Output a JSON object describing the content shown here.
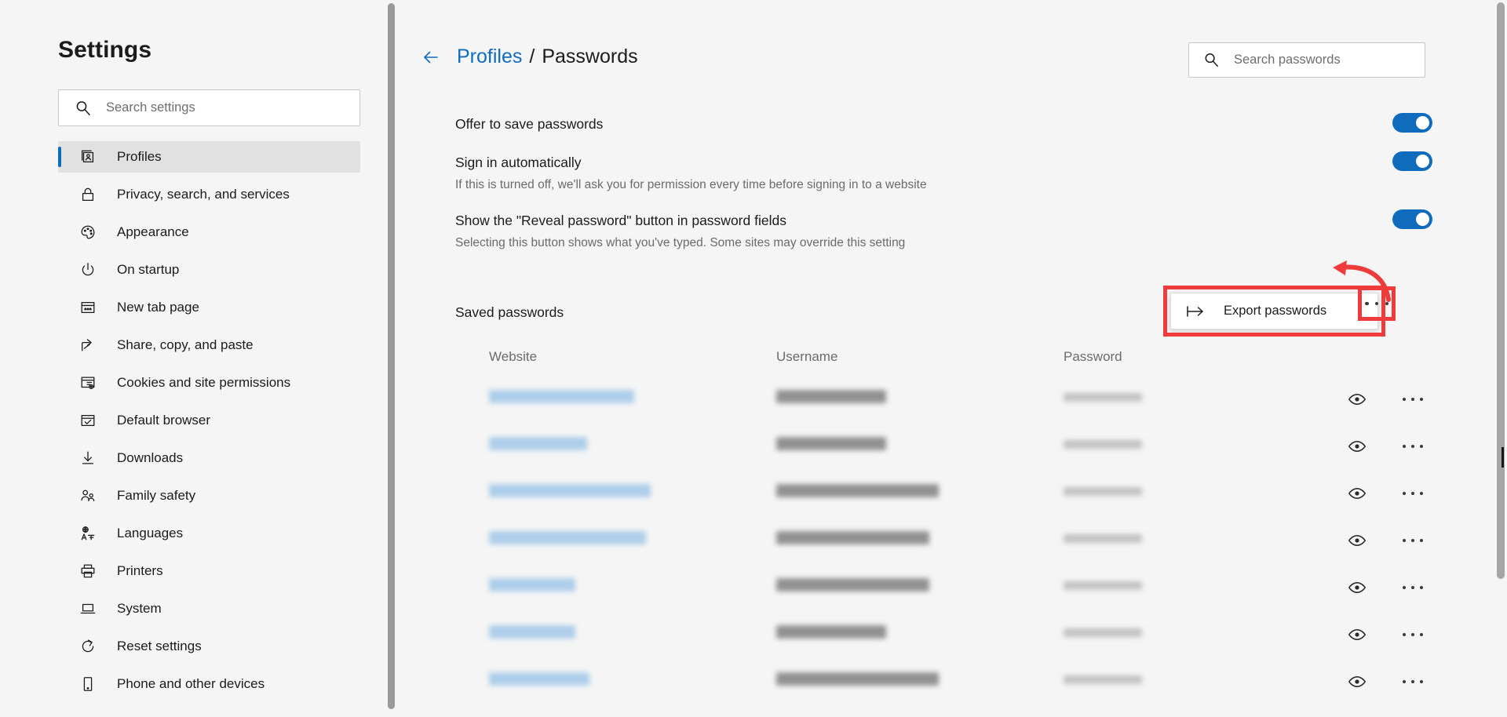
{
  "sidebar": {
    "title": "Settings",
    "search": {
      "placeholder": "Search settings",
      "value": "",
      "icon": "search-icon"
    },
    "items": [
      {
        "label": "Profiles",
        "icon": "profiles-icon",
        "selected": true
      },
      {
        "label": "Privacy, search, and services",
        "icon": "lock-icon",
        "selected": false
      },
      {
        "label": "Appearance",
        "icon": "palette-icon",
        "selected": false
      },
      {
        "label": "On startup",
        "icon": "power-icon",
        "selected": false
      },
      {
        "label": "New tab page",
        "icon": "new-tab-icon",
        "selected": false
      },
      {
        "label": "Share, copy, and paste",
        "icon": "share-icon",
        "selected": false
      },
      {
        "label": "Cookies and site permissions",
        "icon": "cookies-icon",
        "selected": false
      },
      {
        "label": "Default browser",
        "icon": "browser-check-icon",
        "selected": false
      },
      {
        "label": "Downloads",
        "icon": "download-icon",
        "selected": false
      },
      {
        "label": "Family safety",
        "icon": "family-icon",
        "selected": false
      },
      {
        "label": "Languages",
        "icon": "languages-icon",
        "selected": false
      },
      {
        "label": "Printers",
        "icon": "printer-icon",
        "selected": false
      },
      {
        "label": "System",
        "icon": "laptop-icon",
        "selected": false
      },
      {
        "label": "Reset settings",
        "icon": "reset-icon",
        "selected": false
      },
      {
        "label": "Phone and other devices",
        "icon": "phone-icon",
        "selected": false
      }
    ]
  },
  "header": {
    "back_icon": "back-arrow-icon",
    "breadcrumb_parent": "Profiles",
    "breadcrumb_separator": "/",
    "breadcrumb_current": "Passwords",
    "search": {
      "placeholder": "Search passwords",
      "value": "",
      "icon": "search-icon"
    }
  },
  "settings": [
    {
      "title": "Offer to save passwords",
      "description": "",
      "toggle_on": true
    },
    {
      "title": "Sign in automatically",
      "description": "If this is turned off, we'll ask you for permission every time before signing in to a website",
      "toggle_on": true
    },
    {
      "title": "Show the \"Reveal password\" button in password fields",
      "description": "Selecting this button shows what you've typed. Some sites may override this setting",
      "toggle_on": true
    }
  ],
  "saved_passwords": {
    "heading": "Saved passwords",
    "columns": [
      "Website",
      "Username",
      "Password"
    ],
    "more_options_icon": "ellipsis-icon",
    "rows": [
      {
        "website": "",
        "username": "",
        "password": "",
        "site_width": 185,
        "user_width": 140,
        "pass_width": 100,
        "reveal_icon": "eye-icon",
        "menu_icon": "ellipsis-icon"
      },
      {
        "website": "",
        "username": "",
        "password": "",
        "site_width": 125,
        "user_width": 140,
        "pass_width": 100,
        "reveal_icon": "eye-icon",
        "menu_icon": "ellipsis-icon"
      },
      {
        "website": "",
        "username": "",
        "password": "",
        "site_width": 206,
        "user_width": 207,
        "pass_width": 100,
        "reveal_icon": "eye-icon",
        "menu_icon": "ellipsis-icon"
      },
      {
        "website": "",
        "username": "",
        "password": "",
        "site_width": 200,
        "user_width": 195,
        "pass_width": 100,
        "reveal_icon": "eye-icon",
        "menu_icon": "ellipsis-icon"
      },
      {
        "website": "",
        "username": "",
        "password": "",
        "site_width": 110,
        "user_width": 195,
        "pass_width": 100,
        "reveal_icon": "eye-icon",
        "menu_icon": "ellipsis-icon"
      },
      {
        "website": "",
        "username": "",
        "password": "",
        "site_width": 110,
        "user_width": 140,
        "pass_width": 100,
        "reveal_icon": "eye-icon",
        "menu_icon": "ellipsis-icon"
      },
      {
        "website": "",
        "username": "",
        "password": "",
        "site_width": 128,
        "user_width": 207,
        "pass_width": 100,
        "reveal_icon": "eye-icon",
        "menu_icon": "ellipsis-icon"
      }
    ]
  },
  "export_menu": {
    "label": "Export passwords",
    "icon": "export-icon",
    "visible": true
  },
  "annotations": {
    "highlight_color": "#ee3b3b",
    "arrow_icon": "curved-arrow-icon"
  },
  "colors": {
    "accent": "#0f6cbd",
    "link": "#0f6cbd",
    "background": "#f5f5f5",
    "toggle_on": "#0f6cbd",
    "annotation": "#ee3b3b"
  }
}
